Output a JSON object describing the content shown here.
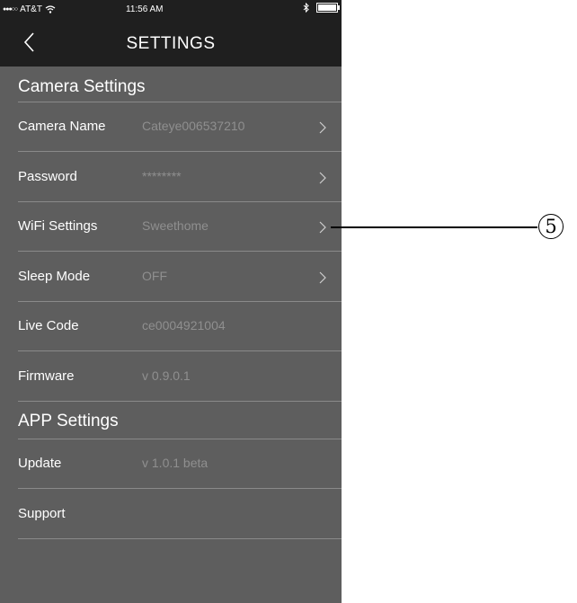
{
  "status_bar": {
    "signal_dots": "●●●○○",
    "carrier": "AT&T",
    "time": "11:56 AM",
    "bluetooth_icon": "bluetooth-icon",
    "battery_level": 1.0
  },
  "navbar": {
    "back_icon": "chevron-left-icon",
    "title": "SETTINGS"
  },
  "sections": {
    "camera_title": "Camera Settings",
    "app_title": "APP Settings"
  },
  "camera_settings": [
    {
      "label": "Camera Name",
      "value": "Cateye006537210",
      "has_chevron": true
    },
    {
      "label": "Password",
      "value": "********",
      "has_chevron": true
    },
    {
      "label": "WiFi Settings",
      "value": "Sweethome",
      "has_chevron": true
    },
    {
      "label": "Sleep Mode",
      "value": "OFF",
      "has_chevron": true
    },
    {
      "label": "Live Code",
      "value": "ce0004921004",
      "has_chevron": false
    },
    {
      "label": "Firmware",
      "value": "v 0.9.0.1",
      "has_chevron": false
    }
  ],
  "app_settings": [
    {
      "label": "Update",
      "value": "v 1.0.1 beta",
      "has_chevron": false
    },
    {
      "label": "Support",
      "value": "",
      "has_chevron": false
    }
  ],
  "callout": {
    "number": "5"
  },
  "colors": {
    "background": "#5e5e5e",
    "bar": "#1f1f1f",
    "value_text": "#8f8f8f",
    "divider": "#8a8a8a"
  }
}
